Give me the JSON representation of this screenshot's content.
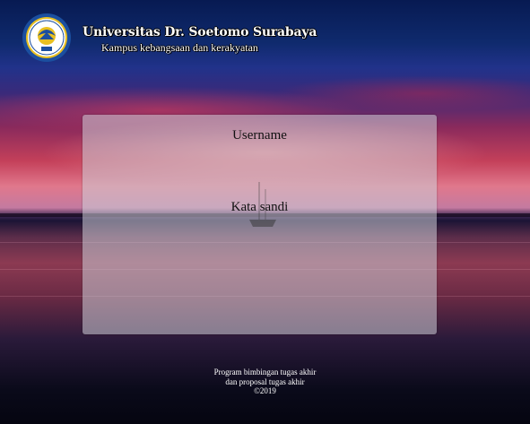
{
  "header": {
    "title": "Universitas Dr. Soetomo Surabaya",
    "subtitle": "Kampus kebangsaan dan kerakyatan",
    "logo_icon": "university-seal-icon"
  },
  "login": {
    "username_label": "Username",
    "username_value": "",
    "password_label": "Kata sandi",
    "password_value": ""
  },
  "footer": {
    "line1": "Program bimbingan tugas akhir",
    "line2": "dan proposal tugas akhir",
    "line3": "©2019"
  },
  "colors": {
    "panel": "#cdcdd7",
    "text_light": "#ffffff",
    "text_dark": "#111111",
    "logo_blue": "#1b4fa0",
    "logo_gold": "#e8c021"
  }
}
